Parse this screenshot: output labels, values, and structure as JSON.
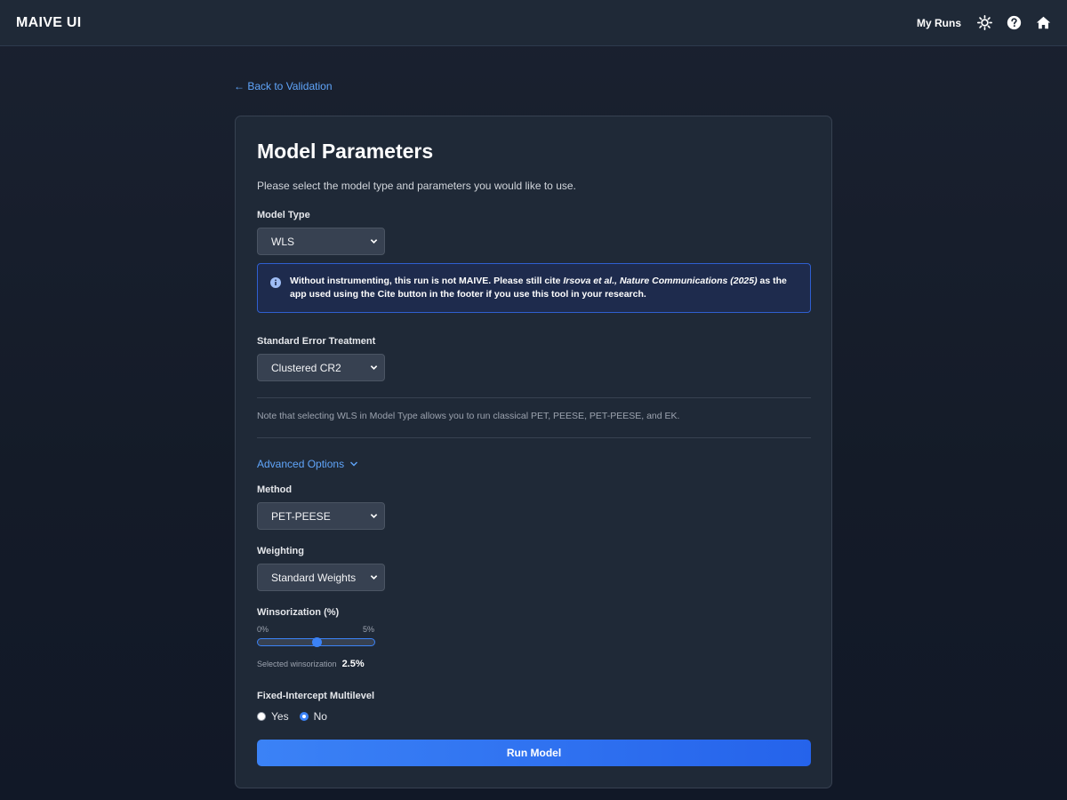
{
  "app": {
    "brand": "MAIVE UI"
  },
  "header": {
    "my_runs": "My Runs",
    "icons": [
      "theme-toggle-icon",
      "help-icon",
      "home-icon"
    ]
  },
  "back_link": "← Back to Validation",
  "card": {
    "title": "Model Parameters",
    "subtitle": "Please select the model type and parameters you would like to use.",
    "model_type": {
      "label": "Model Type",
      "value": "WLS"
    },
    "info": {
      "part1": "Without instrumenting, this run is not MAIVE. Please still cite ",
      "citation": "Irsova et al., Nature Communications (2025)",
      "part2": " as the app used using the ",
      "cite_word": "Cite",
      "part3": " button in the footer if you use this tool in your research."
    },
    "se_treatment": {
      "label": "Standard Error Treatment",
      "value": "Clustered CR2"
    },
    "note": "Note that selecting WLS in Model Type allows you to run classical PET, PEESE, PET-PEESE, and EK.",
    "advanced_label": "Advanced Options",
    "method": {
      "label": "Method",
      "value": "PET-PEESE"
    },
    "weighting": {
      "label": "Weighting",
      "value": "Standard Weights"
    },
    "winsorization": {
      "label": "Winsorization (%)",
      "min_label": "0%",
      "max_label": "5%",
      "min": 0,
      "max": 5,
      "value": 2.5,
      "selected_label": "Selected winsorization",
      "selected_value": "2.5%"
    },
    "fixed_intercept": {
      "label": "Fixed-Intercept Multilevel",
      "options": [
        "Yes",
        "No"
      ],
      "selected": "No"
    },
    "run_button": "Run Model"
  },
  "colors": {
    "accent": "#3b82f6",
    "link": "#60a5fa",
    "card_bg": "#1f2937",
    "info_border": "#2f5fd0"
  }
}
